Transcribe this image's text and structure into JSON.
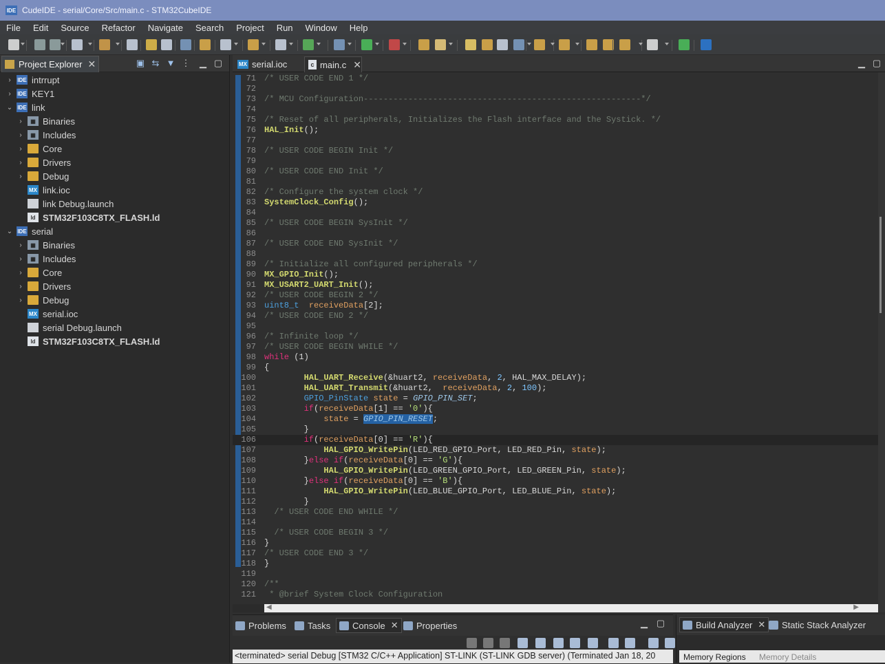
{
  "window": {
    "title": "CudeIDE - serial/Core/Src/main.c - STM32CubeIDE",
    "icon_text": "IDE"
  },
  "menu": [
    "File",
    "Edit",
    "Source",
    "Refactor",
    "Navigate",
    "Search",
    "Project",
    "Run",
    "Window",
    "Help"
  ],
  "project_explorer": {
    "tab_label": "Project Explorer",
    "tree": [
      {
        "label": "intrrupt",
        "icon": "IDE",
        "kind": "ide",
        "depth": 0,
        "arrow": "›",
        "bold": false
      },
      {
        "label": "KEY1",
        "icon": "IDE",
        "kind": "ide",
        "depth": 0,
        "arrow": "›",
        "bold": false
      },
      {
        "label": "link",
        "icon": "IDE",
        "kind": "ide",
        "depth": 0,
        "arrow": "⌄",
        "bold": false
      },
      {
        "label": "Binaries",
        "icon": "▦",
        "kind": "lib",
        "depth": 1,
        "arrow": "›",
        "bold": false
      },
      {
        "label": "Includes",
        "icon": "▦",
        "kind": "lib",
        "depth": 1,
        "arrow": "›",
        "bold": false
      },
      {
        "label": "Core",
        "icon": "",
        "kind": "fold",
        "depth": 1,
        "arrow": "›",
        "bold": false
      },
      {
        "label": "Drivers",
        "icon": "",
        "kind": "fold",
        "depth": 1,
        "arrow": "›",
        "bold": false
      },
      {
        "label": "Debug",
        "icon": "",
        "kind": "fold",
        "depth": 1,
        "arrow": "›",
        "bold": false
      },
      {
        "label": "link.ioc",
        "icon": "MX",
        "kind": "mx",
        "depth": 1,
        "arrow": "",
        "bold": false
      },
      {
        "label": "link Debug.launch",
        "icon": "",
        "kind": "doc",
        "depth": 1,
        "arrow": "",
        "bold": false
      },
      {
        "label": "STM32F103C8TX_FLASH.ld",
        "icon": "ld",
        "kind": "ld",
        "depth": 1,
        "arrow": "",
        "bold": true
      },
      {
        "label": "serial",
        "icon": "IDE",
        "kind": "ide",
        "depth": 0,
        "arrow": "⌄",
        "bold": false
      },
      {
        "label": "Binaries",
        "icon": "▦",
        "kind": "lib",
        "depth": 1,
        "arrow": "›",
        "bold": false
      },
      {
        "label": "Includes",
        "icon": "▦",
        "kind": "lib",
        "depth": 1,
        "arrow": "›",
        "bold": false
      },
      {
        "label": "Core",
        "icon": "",
        "kind": "fold",
        "depth": 1,
        "arrow": "›",
        "bold": false
      },
      {
        "label": "Drivers",
        "icon": "",
        "kind": "fold",
        "depth": 1,
        "arrow": "›",
        "bold": false
      },
      {
        "label": "Debug",
        "icon": "",
        "kind": "fold",
        "depth": 1,
        "arrow": "›",
        "bold": false
      },
      {
        "label": "serial.ioc",
        "icon": "MX",
        "kind": "mx",
        "depth": 1,
        "arrow": "",
        "bold": false
      },
      {
        "label": "serial Debug.launch",
        "icon": "",
        "kind": "doc",
        "depth": 1,
        "arrow": "",
        "bold": false
      },
      {
        "label": "STM32F103C8TX_FLASH.ld",
        "icon": "ld",
        "kind": "ld",
        "depth": 1,
        "arrow": "",
        "bold": true
      }
    ]
  },
  "editor": {
    "tabs": [
      {
        "label": "serial.ioc",
        "icon": "MX",
        "active": false
      },
      {
        "label": "main.c",
        "icon": "c",
        "active": true
      }
    ],
    "current_line": 106,
    "lines": [
      {
        "n": "71",
        "html": "<span class='cm'>/* USER CODE END 1 */</span>"
      },
      {
        "n": "72",
        "html": ""
      },
      {
        "n": "73",
        "html": "<span class='cm'>/* MCU Configuration--------------------------------------------------------*/</span>"
      },
      {
        "n": "74",
        "html": ""
      },
      {
        "n": "75",
        "html": "<span class='cm'>/* Reset of all peripherals, Initializes the Flash interface and the Systick. */</span>"
      },
      {
        "n": "76",
        "html": "<span class='fn'>HAL_Init</span>();"
      },
      {
        "n": "77",
        "html": ""
      },
      {
        "n": "78",
        "html": "<span class='cm'>/* USER CODE BEGIN Init */</span>"
      },
      {
        "n": "79",
        "html": ""
      },
      {
        "n": "80",
        "html": "<span class='cm'>/* USER CODE END Init */</span>"
      },
      {
        "n": "81",
        "html": ""
      },
      {
        "n": "82",
        "html": "<span class='cm'>/* Configure the system clock */</span>"
      },
      {
        "n": "83",
        "html": "<span class='fn'>SystemClock_Config</span>();"
      },
      {
        "n": "84",
        "html": ""
      },
      {
        "n": "85",
        "html": "<span class='cm'>/* USER CODE BEGIN SysInit */</span>"
      },
      {
        "n": "86",
        "html": ""
      },
      {
        "n": "87",
        "html": "<span class='cm'>/* USER CODE END SysInit */</span>"
      },
      {
        "n": "88",
        "html": ""
      },
      {
        "n": "89",
        "html": "<span class='cm'>/* Initialize all configured peripherals */</span>"
      },
      {
        "n": "90",
        "html": "<span class='fn'>MX_GPIO_Init</span>();"
      },
      {
        "n": "91",
        "html": "<span class='fn'>MX_USART2_UART_Init</span>();"
      },
      {
        "n": "92",
        "html": "<span class='cm'>/* USER CODE BEGIN 2 */</span>"
      },
      {
        "n": "93",
        "html": "<span class='ty'>uint8_t</span>  <span class='vr'>receiveData</span>[2];"
      },
      {
        "n": "94",
        "html": "<span class='cm'>/* USER CODE END 2 */</span>"
      },
      {
        "n": "95",
        "html": ""
      },
      {
        "n": "96",
        "html": "<span class='cm'>/* Infinite loop */</span>"
      },
      {
        "n": "97",
        "html": "<span class='cm'>/* USER CODE BEGIN WHILE */</span>"
      },
      {
        "n": "98",
        "html": "<span class='kw'>while</span> (1)"
      },
      {
        "n": "99",
        "html": "{"
      },
      {
        "n": "100",
        "html": "        <span class='fn'>HAL_UART_Receive</span>(&amp;huart2, <span class='vr'>receiveData</span>, <span class='nm'>2</span>, HAL_MAX_DELAY);"
      },
      {
        "n": "101",
        "html": "        <span class='fn'>HAL_UART_Transmit</span>(&amp;huart2,  <span class='vr'>receiveData</span>, <span class='nm'>2</span>, <span class='nm'>100</span>);"
      },
      {
        "n": "102",
        "html": "        <span class='ty'>GPIO_PinState</span> <span class='vr'>state</span> = <span class='mc'>GPIO_PIN_SET</span>;"
      },
      {
        "n": "103",
        "html": "        <span class='kw'>if</span>(<span class='vr'>receiveData</span>[1] == <span class='str'>'0'</span>){"
      },
      {
        "n": "104",
        "html": "            <span class='vr'>state</span> = <span class='mc sel'>GPIO_PIN_RESET</span>;"
      },
      {
        "n": "105",
        "html": "        }"
      },
      {
        "n": "106",
        "html": "        <span class='kw'>if</span>(<span class='vr'>receiveData</span>[0] == <span class='str'>'R'</span>){"
      },
      {
        "n": "107",
        "html": "            <span class='fn'>HAL_GPIO_WritePin</span>(LED_RED_GPIO_Port, LED_RED_Pin, <span class='vr'>state</span>);"
      },
      {
        "n": "108",
        "html": "        }<span class='kw'>else if</span>(<span class='vr'>receiveData</span>[0] == <span class='str'>'G'</span>){"
      },
      {
        "n": "109",
        "html": "            <span class='fn'>HAL_GPIO_WritePin</span>(LED_GREEN_GPIO_Port, LED_GREEN_Pin, <span class='vr'>state</span>);"
      },
      {
        "n": "110",
        "html": "        }<span class='kw'>else if</span>(<span class='vr'>receiveData</span>[0] == <span class='str'>'B'</span>){"
      },
      {
        "n": "111",
        "html": "            <span class='fn'>HAL_GPIO_WritePin</span>(LED_BLUE_GPIO_Port, LED_BLUE_Pin, <span class='vr'>state</span>);"
      },
      {
        "n": "112",
        "html": "        }"
      },
      {
        "n": "113",
        "html": "  <span class='cm'>/* USER CODE END WHILE */</span>"
      },
      {
        "n": "114",
        "html": ""
      },
      {
        "n": "115",
        "html": "  <span class='cm'>/* USER CODE BEGIN 3 */</span>"
      },
      {
        "n": "116",
        "html": "}"
      },
      {
        "n": "117",
        "html": "<span class='cm'>/* USER CODE END 3 */</span>"
      },
      {
        "n": "118",
        "html": "}"
      },
      {
        "n": "119",
        "html": ""
      },
      {
        "n": "120",
        "html": "<span class='cm'>/**</span>"
      },
      {
        "n": "121",
        "html": "<span class='cm'> * @brief System Clock Configuration</span>"
      }
    ]
  },
  "bottom_panel": {
    "tabs": [
      {
        "label": "Problems",
        "active": false
      },
      {
        "label": "Tasks",
        "active": false
      },
      {
        "label": "Console",
        "active": true
      },
      {
        "label": "Properties",
        "active": false
      }
    ],
    "console_status": "<terminated> serial Debug [STM32 C/C++ Application] ST-LINK (ST-LINK GDB server) (Terminated Jan 18, 20"
  },
  "build_analyzer": {
    "tabs": [
      {
        "label": "Build Analyzer",
        "active": true
      },
      {
        "label": "Static Stack Analyzer",
        "active": false
      }
    ],
    "subtabs": [
      "Memory Regions",
      "Memory Details"
    ]
  }
}
